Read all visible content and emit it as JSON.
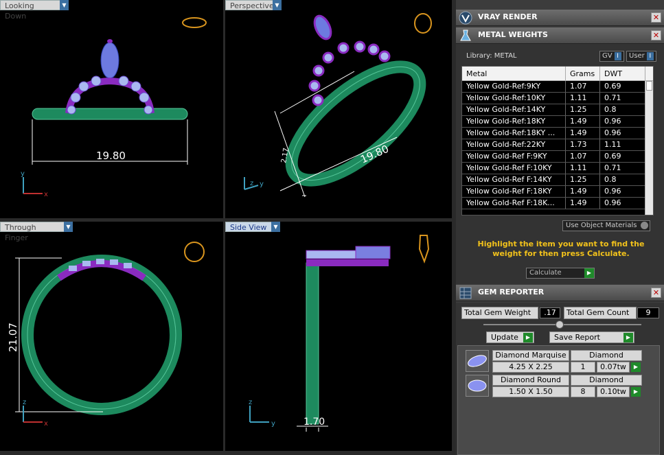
{
  "viewports": {
    "top_left": {
      "label": "Looking Down",
      "dimension": "19.80",
      "axes": [
        "y",
        "x"
      ]
    },
    "top_right": {
      "label": "Perspective",
      "dimension_a": "19.80",
      "dimension_b": "2.17",
      "axes": [
        "z",
        "y"
      ]
    },
    "bottom_left": {
      "label": "Through Finger",
      "dimension": "21.07",
      "axes": [
        "z",
        "x"
      ]
    },
    "bottom_right": {
      "label": "Side View",
      "dimension": "1.70",
      "axes": [
        "z",
        "y"
      ]
    }
  },
  "vray": {
    "title": "VRAY RENDER"
  },
  "metal_weights": {
    "title": "METAL WEIGHTS",
    "library": "Library: METAL",
    "gv_label": "GV",
    "user_label": "User",
    "columns": [
      "Metal",
      "Grams",
      "DWT"
    ],
    "rows": [
      [
        "Yellow Gold-Ref:9KY",
        "1.07",
        "0.69"
      ],
      [
        "Yellow Gold-Ref:10KY",
        "1.11",
        "0.71"
      ],
      [
        "Yellow Gold-Ref:14KY",
        "1.25",
        "0.8"
      ],
      [
        "Yellow Gold-Ref:18KY",
        "1.49",
        "0.96"
      ],
      [
        "Yellow Gold-Ref:18KY ...",
        "1.49",
        "0.96"
      ],
      [
        "Yellow Gold-Ref:22KY",
        "1.73",
        "1.11"
      ],
      [
        "Yellow Gold-Ref F:9KY",
        "1.07",
        "0.69"
      ],
      [
        "Yellow Gold-Ref F:10KY",
        "1.11",
        "0.71"
      ],
      [
        "Yellow Gold-Ref F:14KY",
        "1.25",
        "0.8"
      ],
      [
        "Yellow Gold-Ref F:18KY",
        "1.49",
        "0.96"
      ],
      [
        "Yellow Gold-Ref F:18K...",
        "1.49",
        "0.96"
      ]
    ],
    "use_object_materials": "Use Object Materials",
    "hint": "Highlight the item you want to find the weight for then press Calculate.",
    "calculate_label": "Calculate"
  },
  "gem_reporter": {
    "title": "GEM REPORTER",
    "total_weight_label": "Total Gem Weight",
    "total_weight_value": ".17",
    "total_count_label": "Total Gem Count",
    "total_count_value": "9",
    "update_label": "Update",
    "save_report_label": "Save Report",
    "gems": [
      {
        "name": "Diamond Marquise",
        "size": "4.25 X 2.25",
        "type": "Diamond",
        "count": "1",
        "weight": "0.07tw"
      },
      {
        "name": "Diamond Round",
        "size": "1.50 X 1.50",
        "type": "Diamond",
        "count": "8",
        "weight": "0.10tw"
      }
    ]
  },
  "colors": {
    "band": "#1d8a5e",
    "gem": "#7a7fe0",
    "prong": "#8a2bc0",
    "accent": "#f2c21b"
  }
}
